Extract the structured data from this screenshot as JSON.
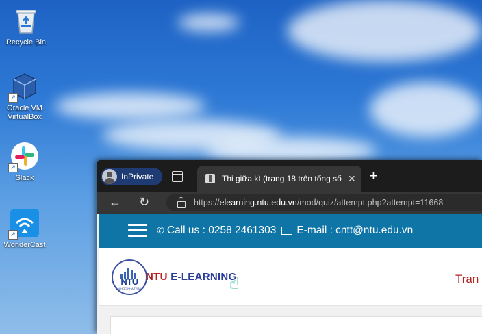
{
  "desktop": {
    "icons": [
      {
        "label": "Recycle Bin",
        "icon": "recycle-bin-icon"
      },
      {
        "label": "Oracle VM VirtualBox",
        "icon": "virtualbox-icon"
      },
      {
        "label": "Slack",
        "icon": "slack-icon"
      },
      {
        "label": "WonderCast",
        "icon": "wondercast-icon"
      }
    ]
  },
  "browser": {
    "inprivate_label": "InPrivate",
    "tab_title": "Thi giữa kì (trang 18 trên tổng số",
    "url_scheme": "https://",
    "url_host": "elearning.ntu.edu.vn",
    "url_path": "/mod/quiz/attempt.php?attempt=11668"
  },
  "site": {
    "phone_text": "Call us : 0258 2461303",
    "email_text": "E-mail : cntt@ntu.edu.vn",
    "logo_text": "NTU",
    "logo_subtext": "ĐẠI HỌC NHA TRANG",
    "brand_ntu": "NTU",
    "brand_rest": " E-LEARNING",
    "nav_partial": "Tran"
  },
  "colors": {
    "site_header": "#0e75a6",
    "brand_blue": "#2a3d9b",
    "brand_red": "#b51f1f",
    "inprivate_pill": "#1f3b73"
  }
}
